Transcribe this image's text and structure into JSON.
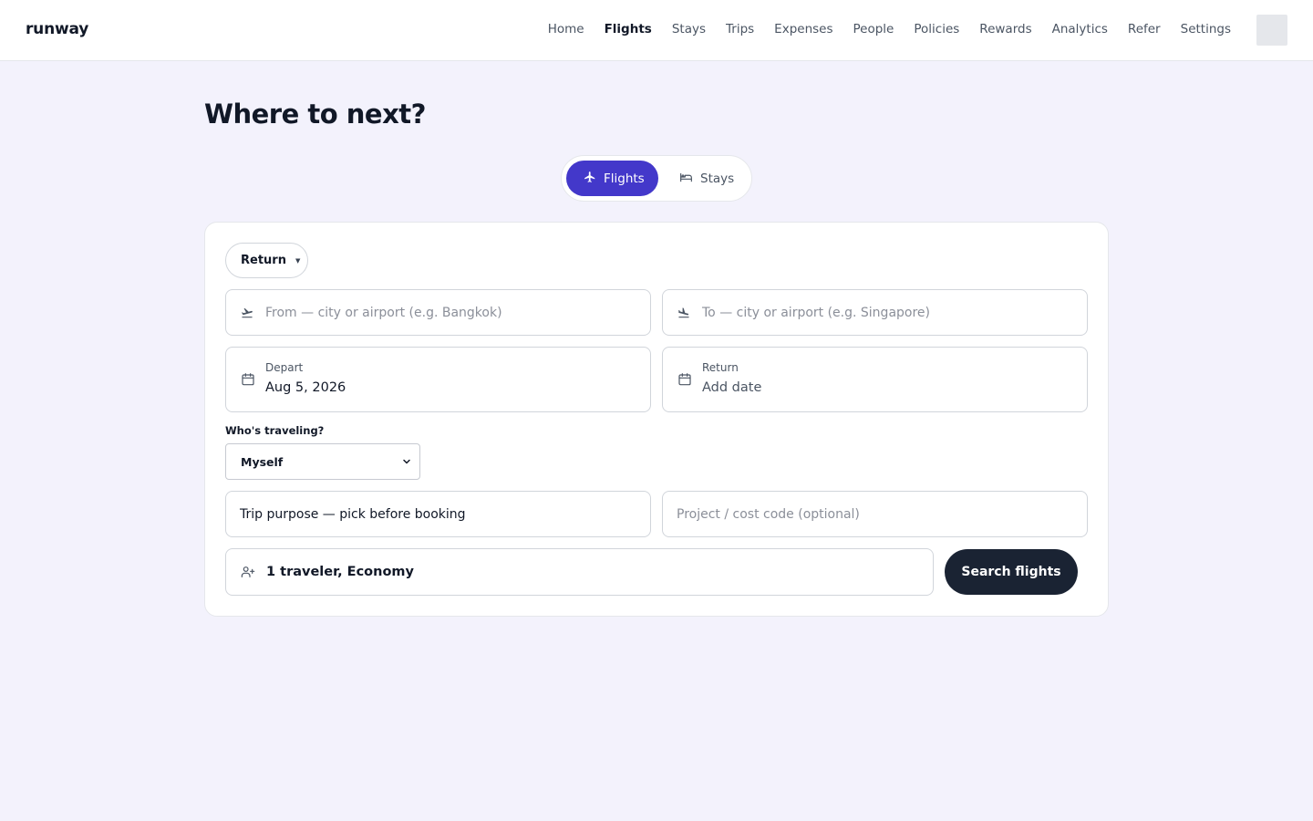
{
  "brand": "runway",
  "nav": [
    {
      "label": "Home",
      "active": false
    },
    {
      "label": "Flights",
      "active": true
    },
    {
      "label": "Stays",
      "active": false
    },
    {
      "label": "Trips",
      "active": false
    },
    {
      "label": "Expenses",
      "active": false
    },
    {
      "label": "People",
      "active": false
    },
    {
      "label": "Policies",
      "active": false
    },
    {
      "label": "Rewards",
      "active": false
    },
    {
      "label": "Analytics",
      "active": false
    },
    {
      "label": "Refer",
      "active": false
    },
    {
      "label": "Settings",
      "active": false
    }
  ],
  "page_title": "Where to next?",
  "mode_switch": {
    "flights_label": "Flights",
    "stays_label": "Stays",
    "selected": "Flights"
  },
  "form": {
    "trip_type": "Return",
    "from_placeholder": "From — city or airport (e.g. Bangkok)",
    "to_placeholder": "To — city or airport (e.g. Singapore)",
    "depart_label": "Depart",
    "depart_value": "Aug 5, 2026",
    "return_label": "Return",
    "return_value": "Add date",
    "who_label": "Who's traveling?",
    "who_value": "Myself",
    "purpose_value": "Trip purpose — pick before booking",
    "project_placeholder": "Project / cost code (optional)",
    "travelers_value": "1 traveler, Economy",
    "search_label": "Search flights"
  },
  "icons": {
    "from": "plane-takeoff-icon",
    "to": "plane-landing-icon",
    "depart": "calendar-icon",
    "return": "calendar-icon",
    "travelers": "user-plus-icon"
  },
  "colors": {
    "accent": "#4338ca",
    "primary_button": "#1a2333",
    "background": "#f3f2fc"
  }
}
